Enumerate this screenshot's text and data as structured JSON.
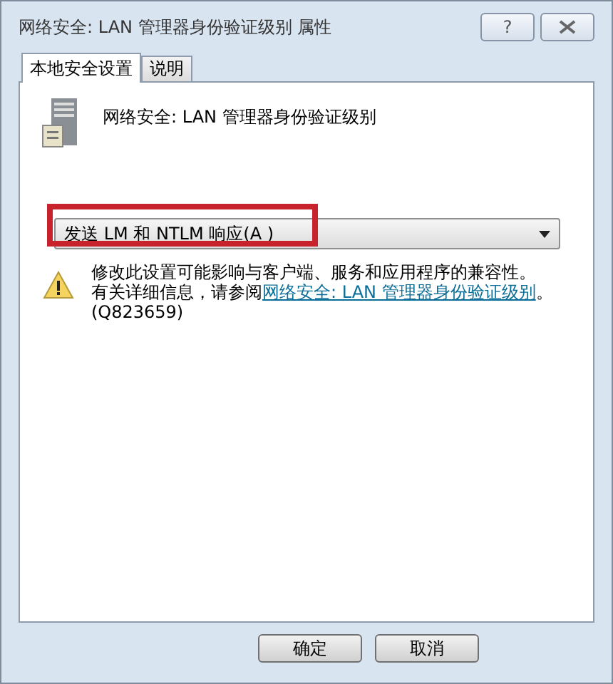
{
  "window": {
    "title": "网络安全: LAN 管理器身份验证级别 属性",
    "help": "?"
  },
  "tabs": [
    {
      "label": "本地安全设置",
      "selected": true
    },
    {
      "label": "说明",
      "selected": false
    }
  ],
  "policy": {
    "name": "网络安全: LAN 管理器身份验证级别"
  },
  "dropdown": {
    "value": "发送 LM 和 NTLM 响应(A )",
    "highlighted": true
  },
  "warning": {
    "line_1": "修改此设置可能影响与客户端、服务和应用程序的兼容性。",
    "line_2_prefix": "有关详细信息，请参阅",
    "link": "网络安全: LAN 管理器身份验证级别",
    "line_2_suffix": "。",
    "line_3": "(Q823659)"
  },
  "buttons": [
    {
      "label": "确定"
    },
    {
      "label": "取消"
    }
  ]
}
